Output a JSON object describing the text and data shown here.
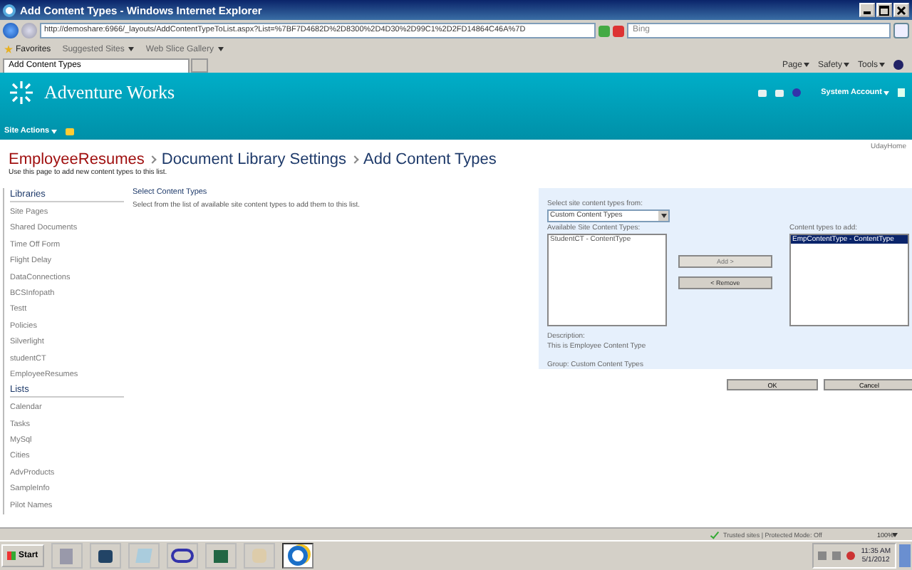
{
  "window": {
    "title": "Add Content Types - Windows Internet Explorer"
  },
  "address_bar": {
    "url": "http://demoshare:6966/_layouts/AddContentTypeToList.aspx?List=%7BF7D4682D%2D8300%2D4D30%2D99C1%2D2FD14864C46A%7D",
    "search_placeholder": "Bing"
  },
  "favorites_bar": {
    "label": "Favorites",
    "links": [
      "Suggested Sites",
      "Web Slice Gallery"
    ]
  },
  "tabs": [
    {
      "label": "Add Content Types",
      "selected": true
    }
  ],
  "command_bar": [
    "Page",
    "Safety",
    "Tools"
  ],
  "site": {
    "title": "Adventure Works",
    "user": "System Account",
    "site_actions": "Site Actions",
    "user_link": "UdayHome"
  },
  "breadcrumb": [
    "EmployeeResumes",
    "Document Library Settings",
    "Add Content Types"
  ],
  "page_description": "Use this page to add new content types to this list.",
  "sidebar": [
    {
      "heading": "Libraries",
      "items": [
        "Site Pages",
        "Shared Documents",
        "Time Off Form",
        "Flight Delay",
        "DataConnections",
        "BCSInfopath",
        "Testt",
        "Policies",
        "Silverlight",
        "studentCT",
        "EmployeeResumes"
      ]
    },
    {
      "heading": "Lists",
      "items": [
        "Calendar",
        "Tasks",
        "MySql",
        "Cities",
        "AdvProducts",
        "SampleInfo",
        "Pilot Names"
      ]
    }
  ],
  "section": {
    "title": "Select Content Types",
    "description": "Select from the list of available site content types to add them to this list."
  },
  "form": {
    "source_label": "Select site content types from:",
    "source_value": "Custom Content Types",
    "available_label": "Available Site Content Types:",
    "available_items": [
      {
        "label": "StudentCT - ContentType",
        "selected": false
      }
    ],
    "add_label": "Content types to add:",
    "to_add_items": [
      {
        "label": "EmpContentType - ContentType",
        "selected": true
      }
    ],
    "buttons": [
      {
        "label": "Add >",
        "disabled": true
      },
      {
        "label": "< Remove",
        "disabled": false
      }
    ],
    "description_label": "Description:",
    "description": "This is Employee Content Type",
    "group": "Group: Custom Content Types"
  },
  "actions": [
    "OK",
    "Cancel"
  ],
  "status_bar": {
    "zone": "Trusted sites | Protected Mode: Off",
    "zoom": "100%"
  },
  "taskbar": {
    "start": "Start",
    "time": "11:35 AM",
    "date": "5/1/2012"
  }
}
